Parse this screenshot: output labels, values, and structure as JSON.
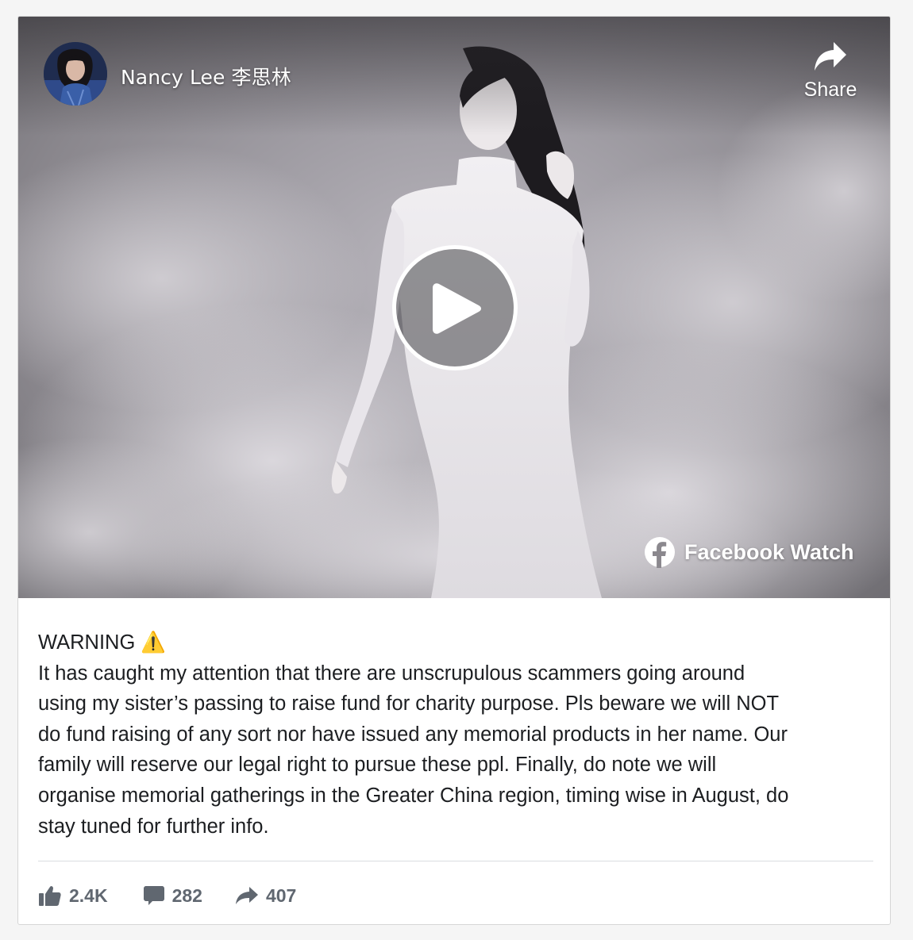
{
  "video": {
    "author_name": "Nancy Lee 李思林",
    "share_label": "Share",
    "watch_label": "Facebook Watch"
  },
  "post": {
    "heading": "WARNING ⚠️",
    "lines": [
      "It has caught my attention that there are unscrupulous scammers going around",
      "using my sister’s passing to raise fund for charity purpose. Pls beware we will NOT",
      "do fund raising of any sort nor have issued any memorial products in her name. Our",
      "family will reserve our legal right to pursue these ppl. Finally, do note we will",
      "organise memorial gatherings in the Greater China region, timing wise in August, do",
      "stay tuned for further info."
    ]
  },
  "stats": {
    "likes": "2.4K",
    "comments": "282",
    "shares": "407"
  },
  "colors": {
    "text": "#1c1e21",
    "muted": "#606770",
    "divider": "#dadde1",
    "warning": "#f5c518"
  },
  "icons": [
    "share-icon",
    "play-icon",
    "facebook-logo-icon",
    "warning-icon",
    "like-icon",
    "comment-icon",
    "share-arrow-icon"
  ]
}
